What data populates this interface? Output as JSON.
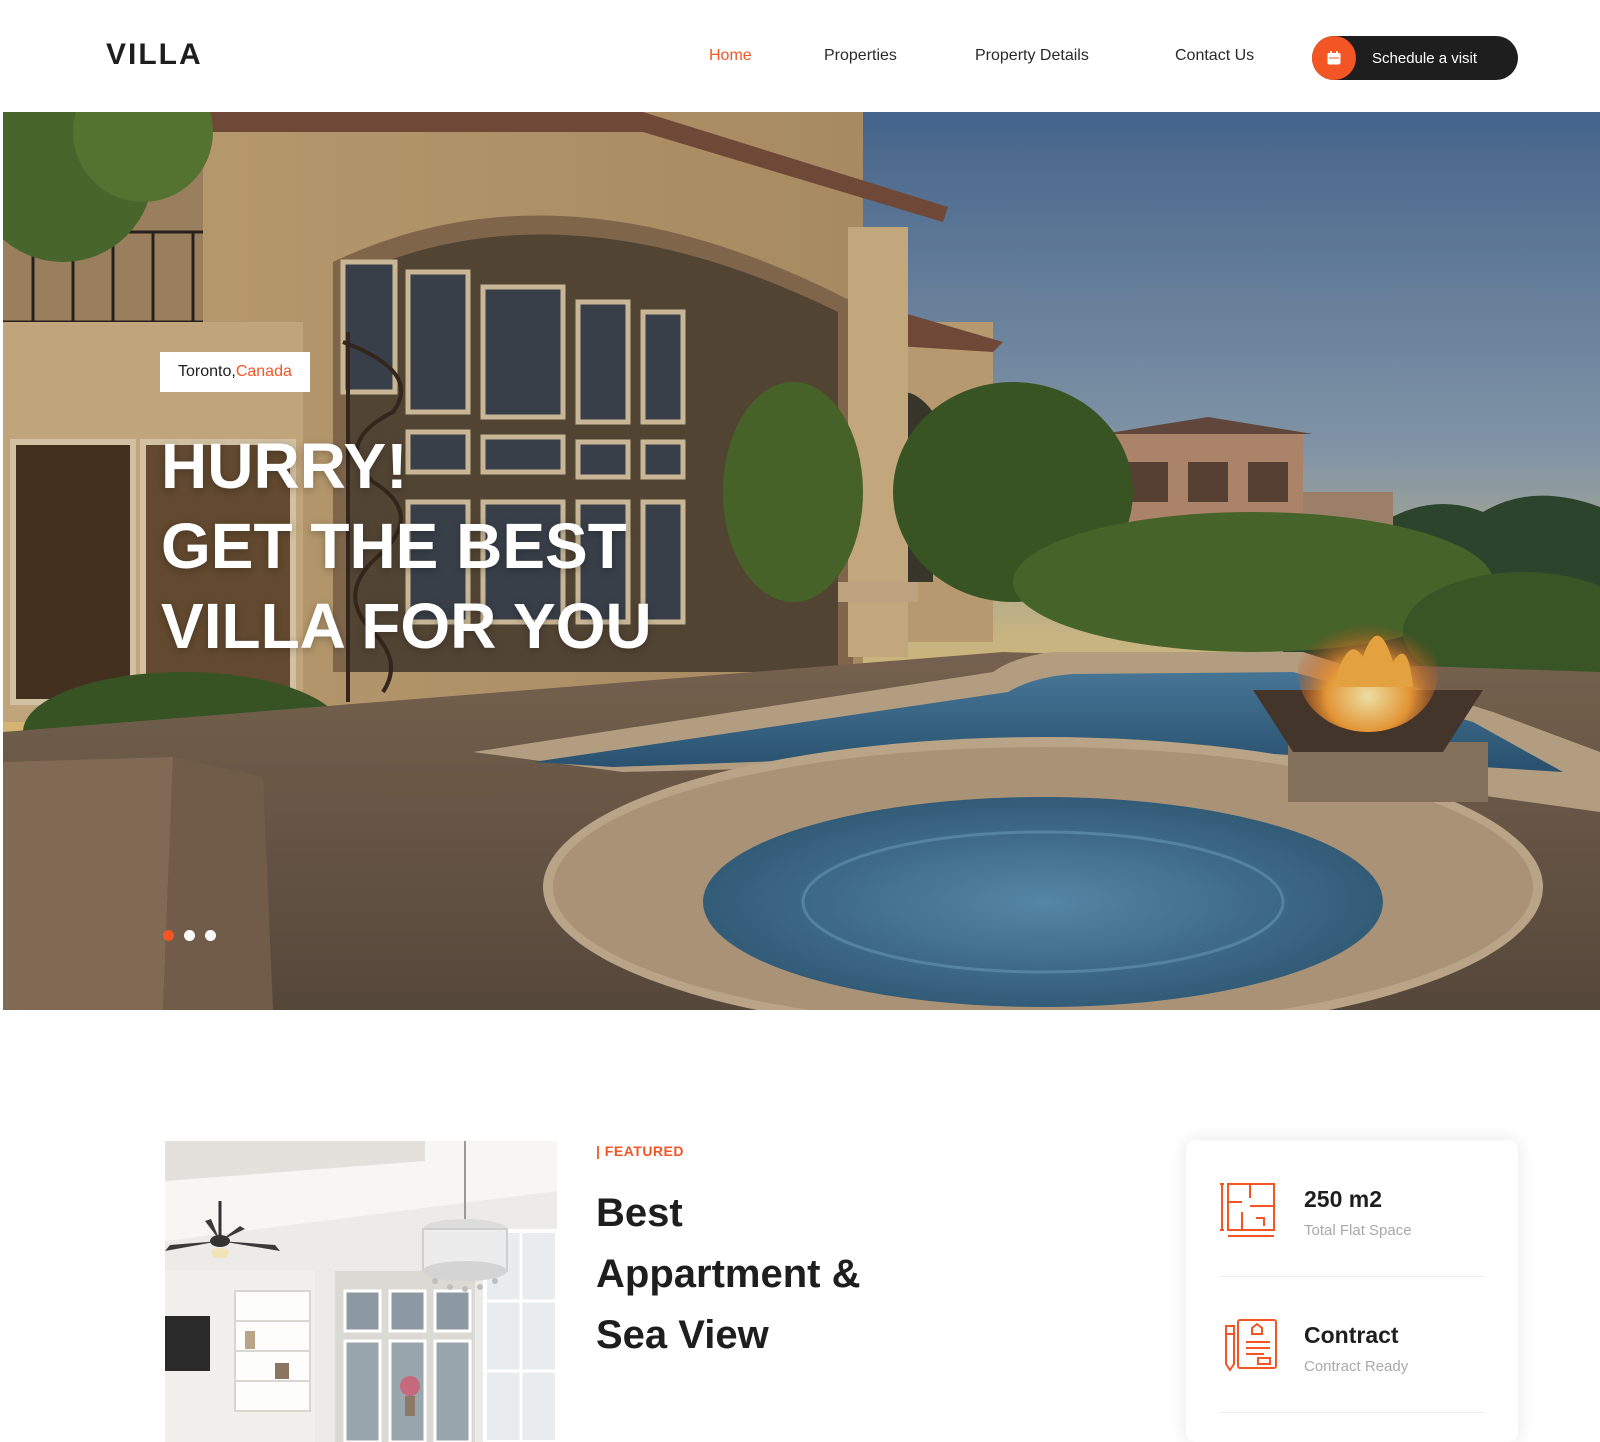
{
  "header": {
    "logo": "VILLA",
    "nav": [
      {
        "label": "Home",
        "active": true
      },
      {
        "label": "Properties",
        "active": false
      },
      {
        "label": "Property Details",
        "active": false
      },
      {
        "label": "Contact Us",
        "active": false
      }
    ],
    "cta_label": "Schedule a visit",
    "cta_icon": "calendar-icon"
  },
  "hero": {
    "location_city": "Toronto, ",
    "location_country": "Canada",
    "title_lines": [
      "HURRY!",
      "GET THE BEST",
      "VILLA FOR YOU"
    ],
    "slides_total": 3,
    "slide_active": 1
  },
  "featured": {
    "tag": "| FEATURED",
    "title_lines": [
      "Best",
      "Appartment &",
      "Sea View"
    ],
    "info": [
      {
        "value": "250 m2",
        "label": "Total Flat Space",
        "icon": "floor-plan-icon"
      },
      {
        "value": "Contract",
        "label": "Contract Ready",
        "icon": "contract-icon"
      }
    ]
  },
  "colors": {
    "accent": "#f35525",
    "dark": "#1e1e1e",
    "muted": "#a9a9a9"
  }
}
